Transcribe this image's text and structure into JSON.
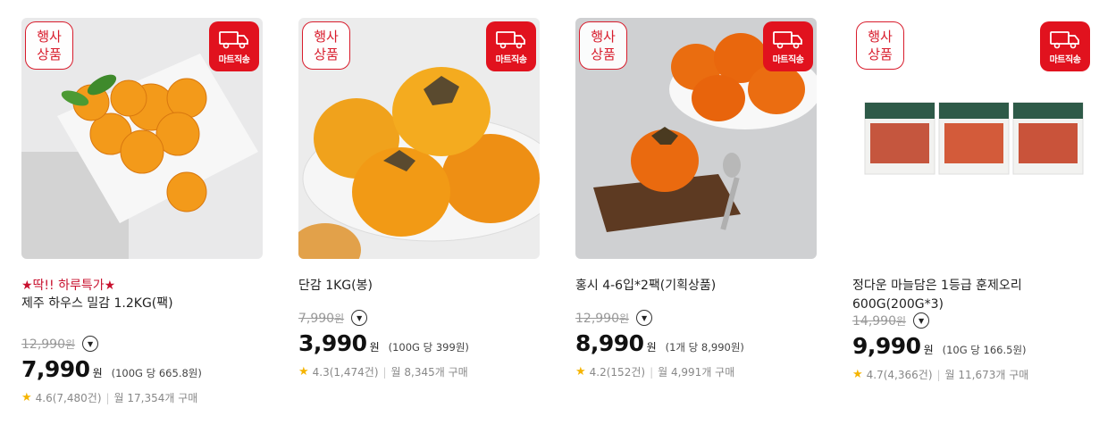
{
  "badges": {
    "event_line1": "행사",
    "event_line2": "상품",
    "mart": "마트직송"
  },
  "products": [
    {
      "promo": "★딱!! 하루특가★",
      "title_lines": [
        "제주 하우스 밀감 1.2KG(팩)"
      ],
      "original_price": "12,990",
      "original_unit": "원",
      "price": "7,990",
      "price_unit": "원",
      "unit_price": "(100G 당 665.8원)",
      "rating": "4.6(7,480건)",
      "monthly": "월 17,354개 구매"
    },
    {
      "promo": "",
      "title_lines": [
        "단감 1KG(봉)"
      ],
      "original_price": "7,990",
      "original_unit": "원",
      "price": "3,990",
      "price_unit": "원",
      "unit_price": "(100G 당 399원)",
      "rating": "4.3(1,474건)",
      "monthly": "월 8,345개 구매"
    },
    {
      "promo": "",
      "title_lines": [
        "홍시 4-6입*2팩(기획상품)"
      ],
      "original_price": "12,990",
      "original_unit": "원",
      "price": "8,990",
      "price_unit": "원",
      "unit_price": "(1개 당 8,990원)",
      "rating": "4.2(152건)",
      "monthly": "월 4,991개 구매"
    },
    {
      "promo": "",
      "title_lines": [
        "정다운 마늘담은 1등급 훈제오리",
        "600G(200G*3)"
      ],
      "original_price": "14,990",
      "original_unit": "원",
      "price": "9,990",
      "price_unit": "원",
      "unit_price": "(10G 당 166.5원)",
      "rating": "4.7(4,366건)",
      "monthly": "월 11,673개 구매"
    }
  ],
  "colors": {
    "accent_red": "#e1121e",
    "promo_red": "#c8102e",
    "star": "#f5b400"
  },
  "icons": [
    "truck-icon",
    "chevron-down-icon",
    "star-icon"
  ]
}
